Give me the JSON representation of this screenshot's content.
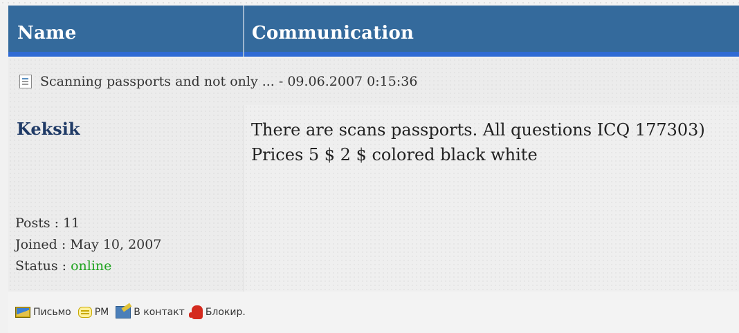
{
  "table": {
    "header": {
      "name_label": "Name",
      "communication_label": "Communication"
    },
    "topic": {
      "icon": "document-icon",
      "text": "Scanning passports and not only ... - 09.06.2007 0:15:36"
    },
    "post": {
      "username": "Keksik",
      "stats": {
        "posts_label": "Posts : ",
        "posts_value": "11",
        "joined_label": "Joined : ",
        "joined_value": "May 10, 2007",
        "status_label": "Status : ",
        "status_value": "online"
      },
      "message_lines": [
        "There are scans passports. All questions ICQ 177303)",
        "Prices 5 $ 2 $ colored black white"
      ]
    },
    "actions": [
      {
        "label": "Письмо",
        "icon": "mail-icon"
      },
      {
        "label": "PM",
        "icon": "pm-icon"
      },
      {
        "label": "В контакт",
        "icon": "add-contact-icon"
      },
      {
        "label": "Блокир.",
        "icon": "block-hand-icon"
      }
    ]
  },
  "colors": {
    "header_bg": "#346a9c",
    "header_accent": "#2f6bd4",
    "username": "#1f3a66",
    "online": "#1ea31e"
  }
}
